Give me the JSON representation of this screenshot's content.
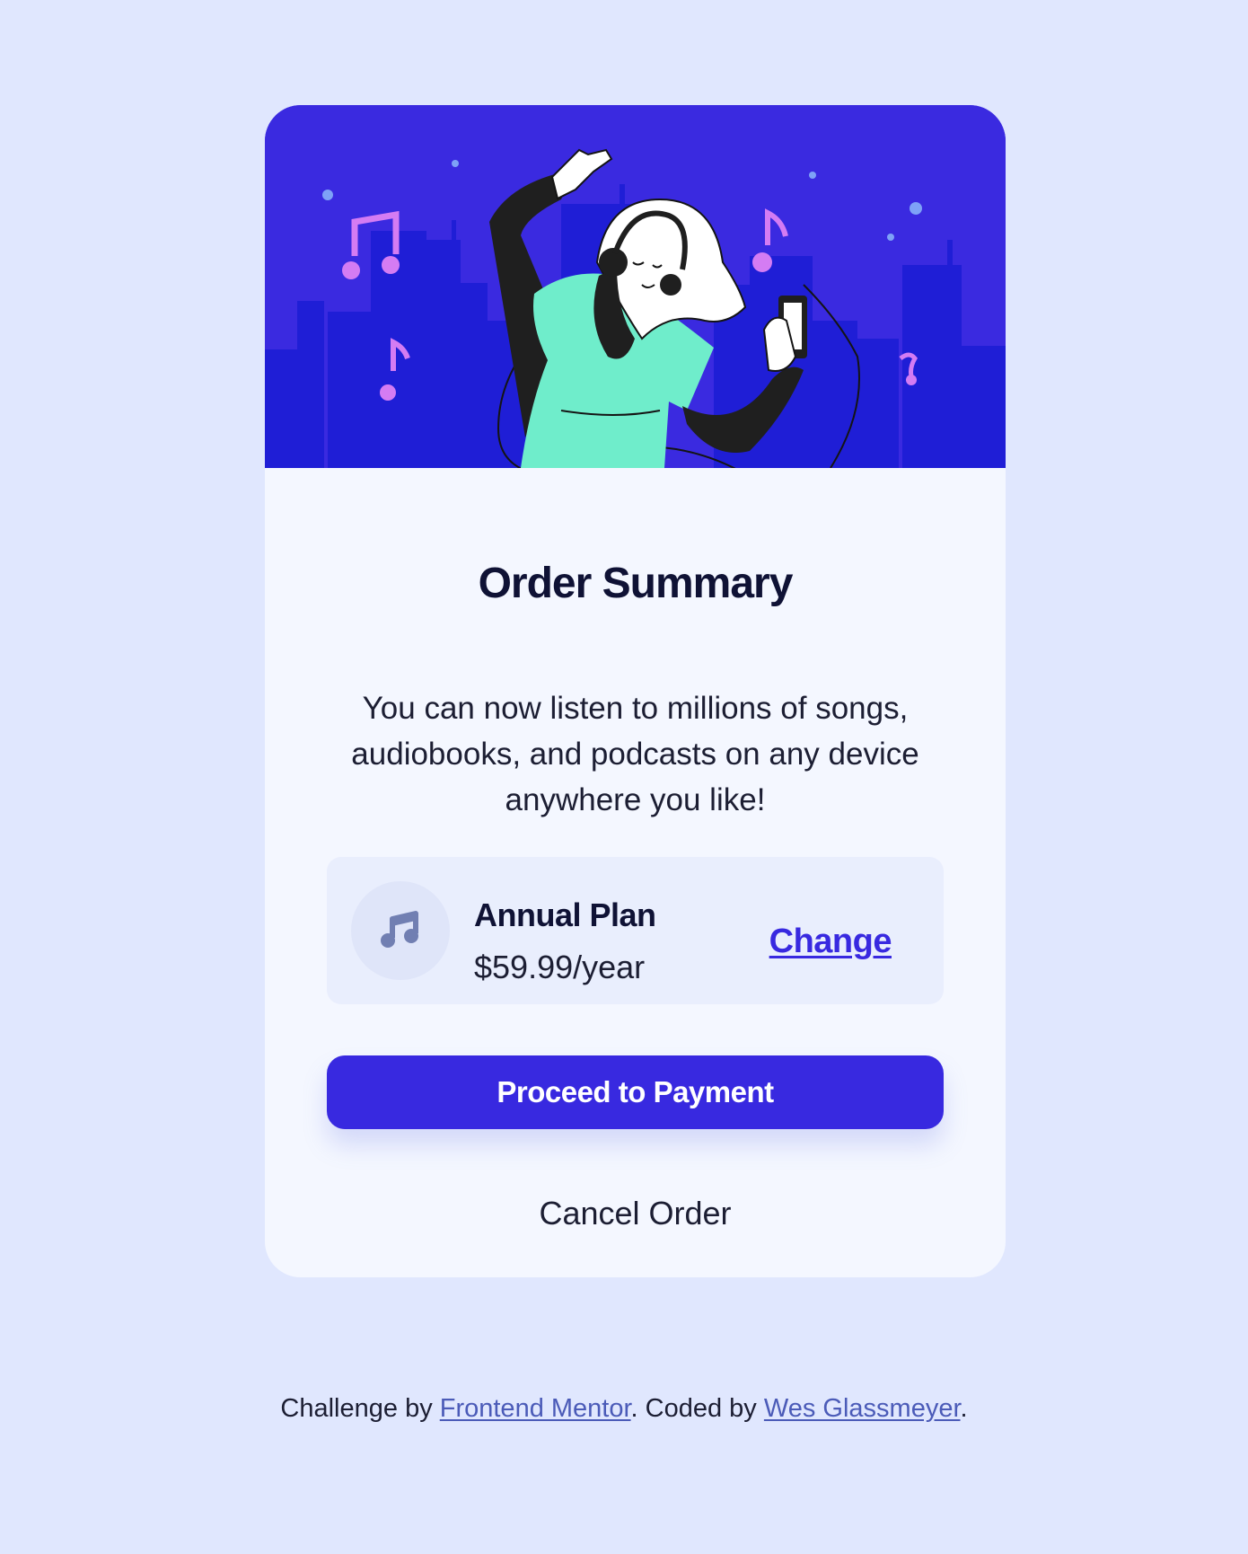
{
  "colors": {
    "page_background": "#e0e7fe",
    "card_background": "#f4f7ff",
    "accent": "#3829e0",
    "plan_panel": "#e9eefd",
    "heading": "#0f1235",
    "link_footer": "#4b5bb8"
  },
  "hero": {
    "illustration": "woman-dancing-with-headphones-city-night"
  },
  "card": {
    "title": "Order Summary",
    "description": "You can now listen to millions of songs, audiobooks, and podcasts on any device anywhere you like!",
    "plan": {
      "icon": "music-note-icon",
      "name": "Annual Plan",
      "price": "$59.99/year",
      "change_label": "Change"
    },
    "primary_button": "Proceed to Payment",
    "cancel_label": "Cancel Order"
  },
  "footer": {
    "prefix": "Challenge by ",
    "mentor_link": "Frontend Mentor",
    "middle": ". Coded by ",
    "author_link": "Wes Glassmeyer",
    "suffix": "."
  }
}
